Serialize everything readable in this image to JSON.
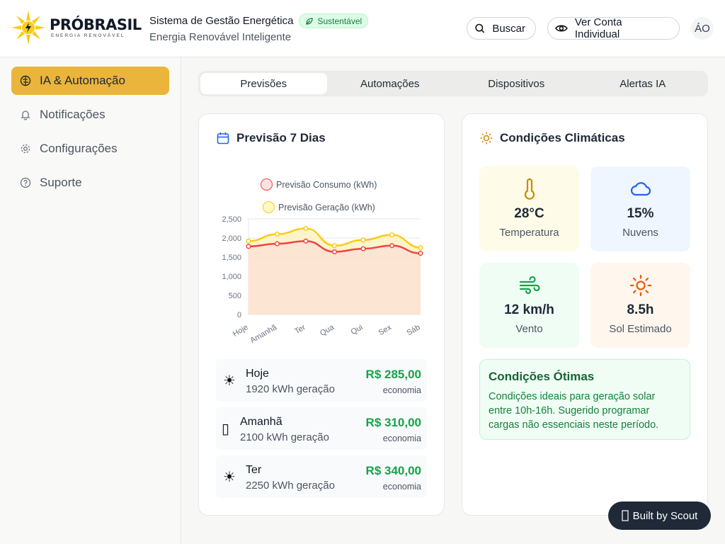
{
  "header": {
    "logo_name": "PRÓBRASIL",
    "logo_tagline": "ENERGIA RENOVÁVEL",
    "system_title": "Sistema de Gestão Energética",
    "badge": "Sustentável",
    "subtitle": "Energia Renovável Inteligente",
    "search_label": "Buscar",
    "view_account_label": "Ver Conta Individual",
    "avatar_initials": "ÁO"
  },
  "sidebar": {
    "items": [
      {
        "label": "IA & Automação",
        "icon": "brain-icon",
        "active": true
      },
      {
        "label": "Notificações",
        "icon": "bell-icon",
        "active": false
      },
      {
        "label": "Configurações",
        "icon": "gear-icon",
        "active": false
      },
      {
        "label": "Suporte",
        "icon": "help-circle-icon",
        "active": false
      }
    ]
  },
  "tabs": [
    {
      "label": "Previsões",
      "active": true
    },
    {
      "label": "Automações",
      "active": false
    },
    {
      "label": "Dispositivos",
      "active": false
    },
    {
      "label": "Alertas IA",
      "active": false
    }
  ],
  "forecast_card": {
    "title": "Previsão 7 Dias",
    "rows": [
      {
        "icon": "☀",
        "day": "Hoje",
        "generation": "1920 kWh geração",
        "saving": "R$ 285,00",
        "saving_label": "economia"
      },
      {
        "icon": "▯",
        "day": "Amanhã",
        "generation": "2100 kWh geração",
        "saving": "R$ 310,00",
        "saving_label": "economia"
      },
      {
        "icon": "☀",
        "day": "Ter",
        "generation": "2250 kWh geração",
        "saving": "R$ 340,00",
        "saving_label": "economia"
      }
    ]
  },
  "chart_data": {
    "type": "area",
    "categories": [
      "Hoje",
      "Amanhã",
      "Ter",
      "Qua",
      "Qui",
      "Sex",
      "Sáb"
    ],
    "series": [
      {
        "name": "Previsão Consumo (kWh)",
        "values": [
          1780,
          1850,
          1920,
          1640,
          1720,
          1800,
          1600
        ],
        "color": "#ef4444",
        "fill": "#fde2d4"
      },
      {
        "name": "Previsão Geração (kWh)",
        "values": [
          1920,
          2100,
          2250,
          1800,
          1950,
          2080,
          1750
        ],
        "color": "#facc15",
        "fill": "#fef3c7"
      }
    ],
    "yticks": [
      "2,500",
      "2,000",
      "1,500",
      "1,000",
      "500",
      "0"
    ],
    "ylim": [
      0,
      2500
    ],
    "grid": true,
    "legend_position": "top"
  },
  "climate_card": {
    "title": "Condições Climáticas",
    "tiles": [
      {
        "value": "28°C",
        "label": "Temperatura",
        "icon": "thermometer-icon",
        "bg": "#fefce8",
        "color": "#ca8a04"
      },
      {
        "value": "15%",
        "label": "Nuvens",
        "icon": "cloud-icon",
        "bg": "#eff6ff",
        "color": "#2563eb"
      },
      {
        "value": "12 km/h",
        "label": "Vento",
        "icon": "wind-icon",
        "bg": "#f0fdf4",
        "color": "#16a34a"
      },
      {
        "value": "8.5h",
        "label": "Sol Estimado",
        "icon": "sun-icon",
        "bg": "#fff7ed",
        "color": "#ea580c"
      }
    ],
    "conditions_title": "Condições Ótimas",
    "conditions_text": "Condições ideais para geração solar entre 10h-16h. Sugerido programar cargas não essenciais neste período."
  },
  "built_by": "Built by Scout"
}
